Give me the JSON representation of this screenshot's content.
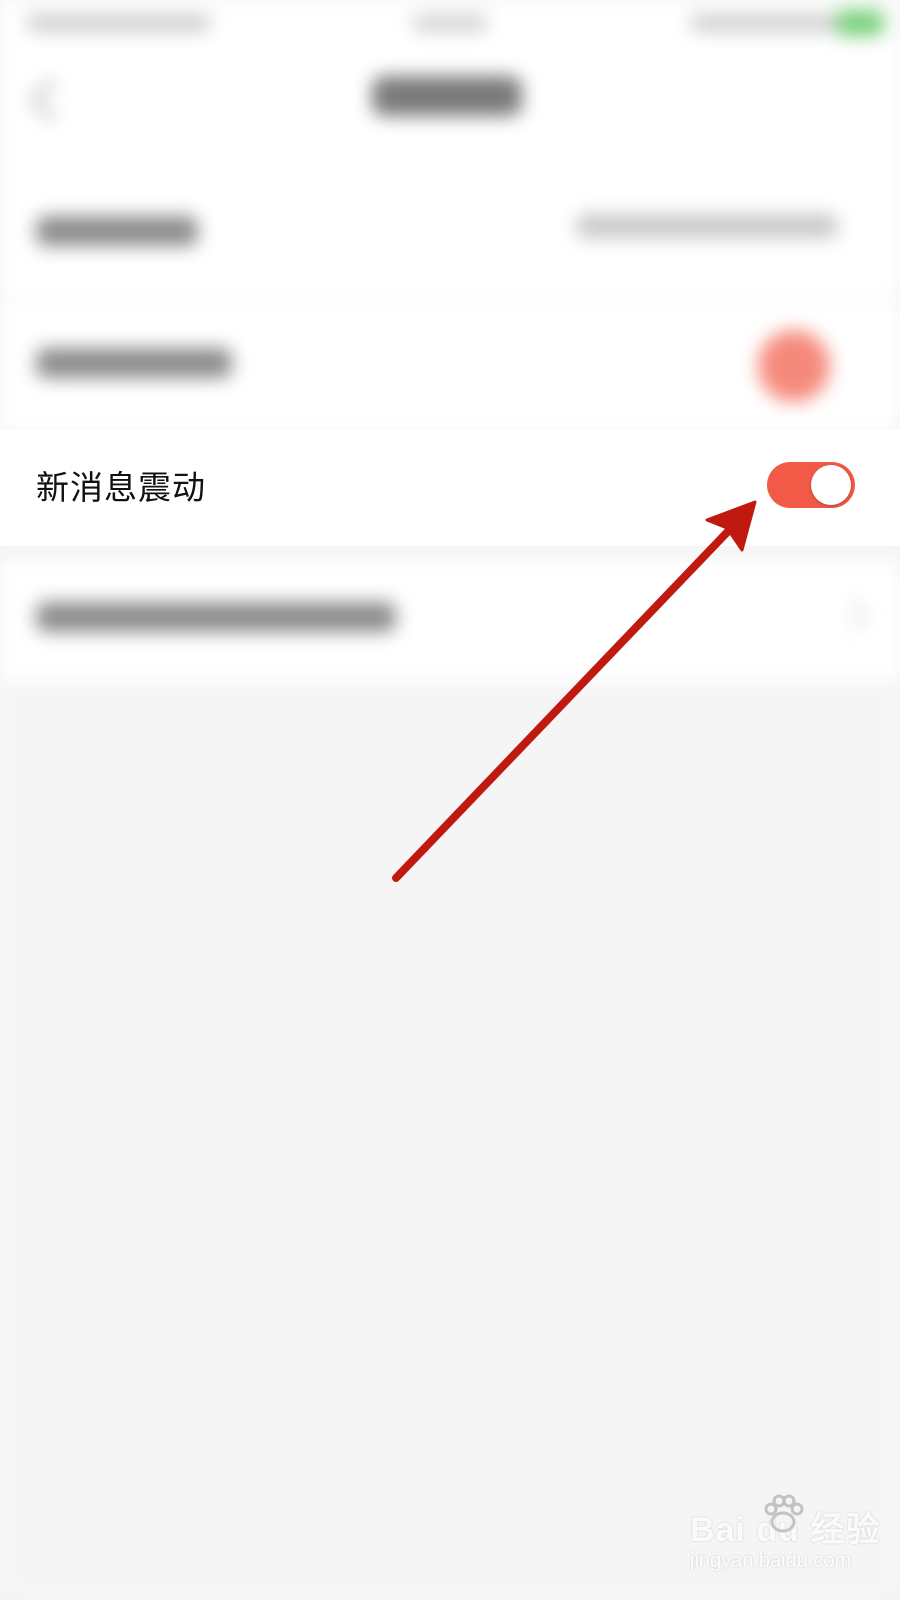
{
  "settings_row": {
    "label": "新消息震动",
    "toggle_on": true,
    "toggle_color": "#f25a47"
  },
  "annotation": {
    "color": "#c0190f",
    "icon": "arrow-icon"
  },
  "watermark": {
    "brand": "Bai  du 经验",
    "url": "jingyan.baidu.com"
  }
}
